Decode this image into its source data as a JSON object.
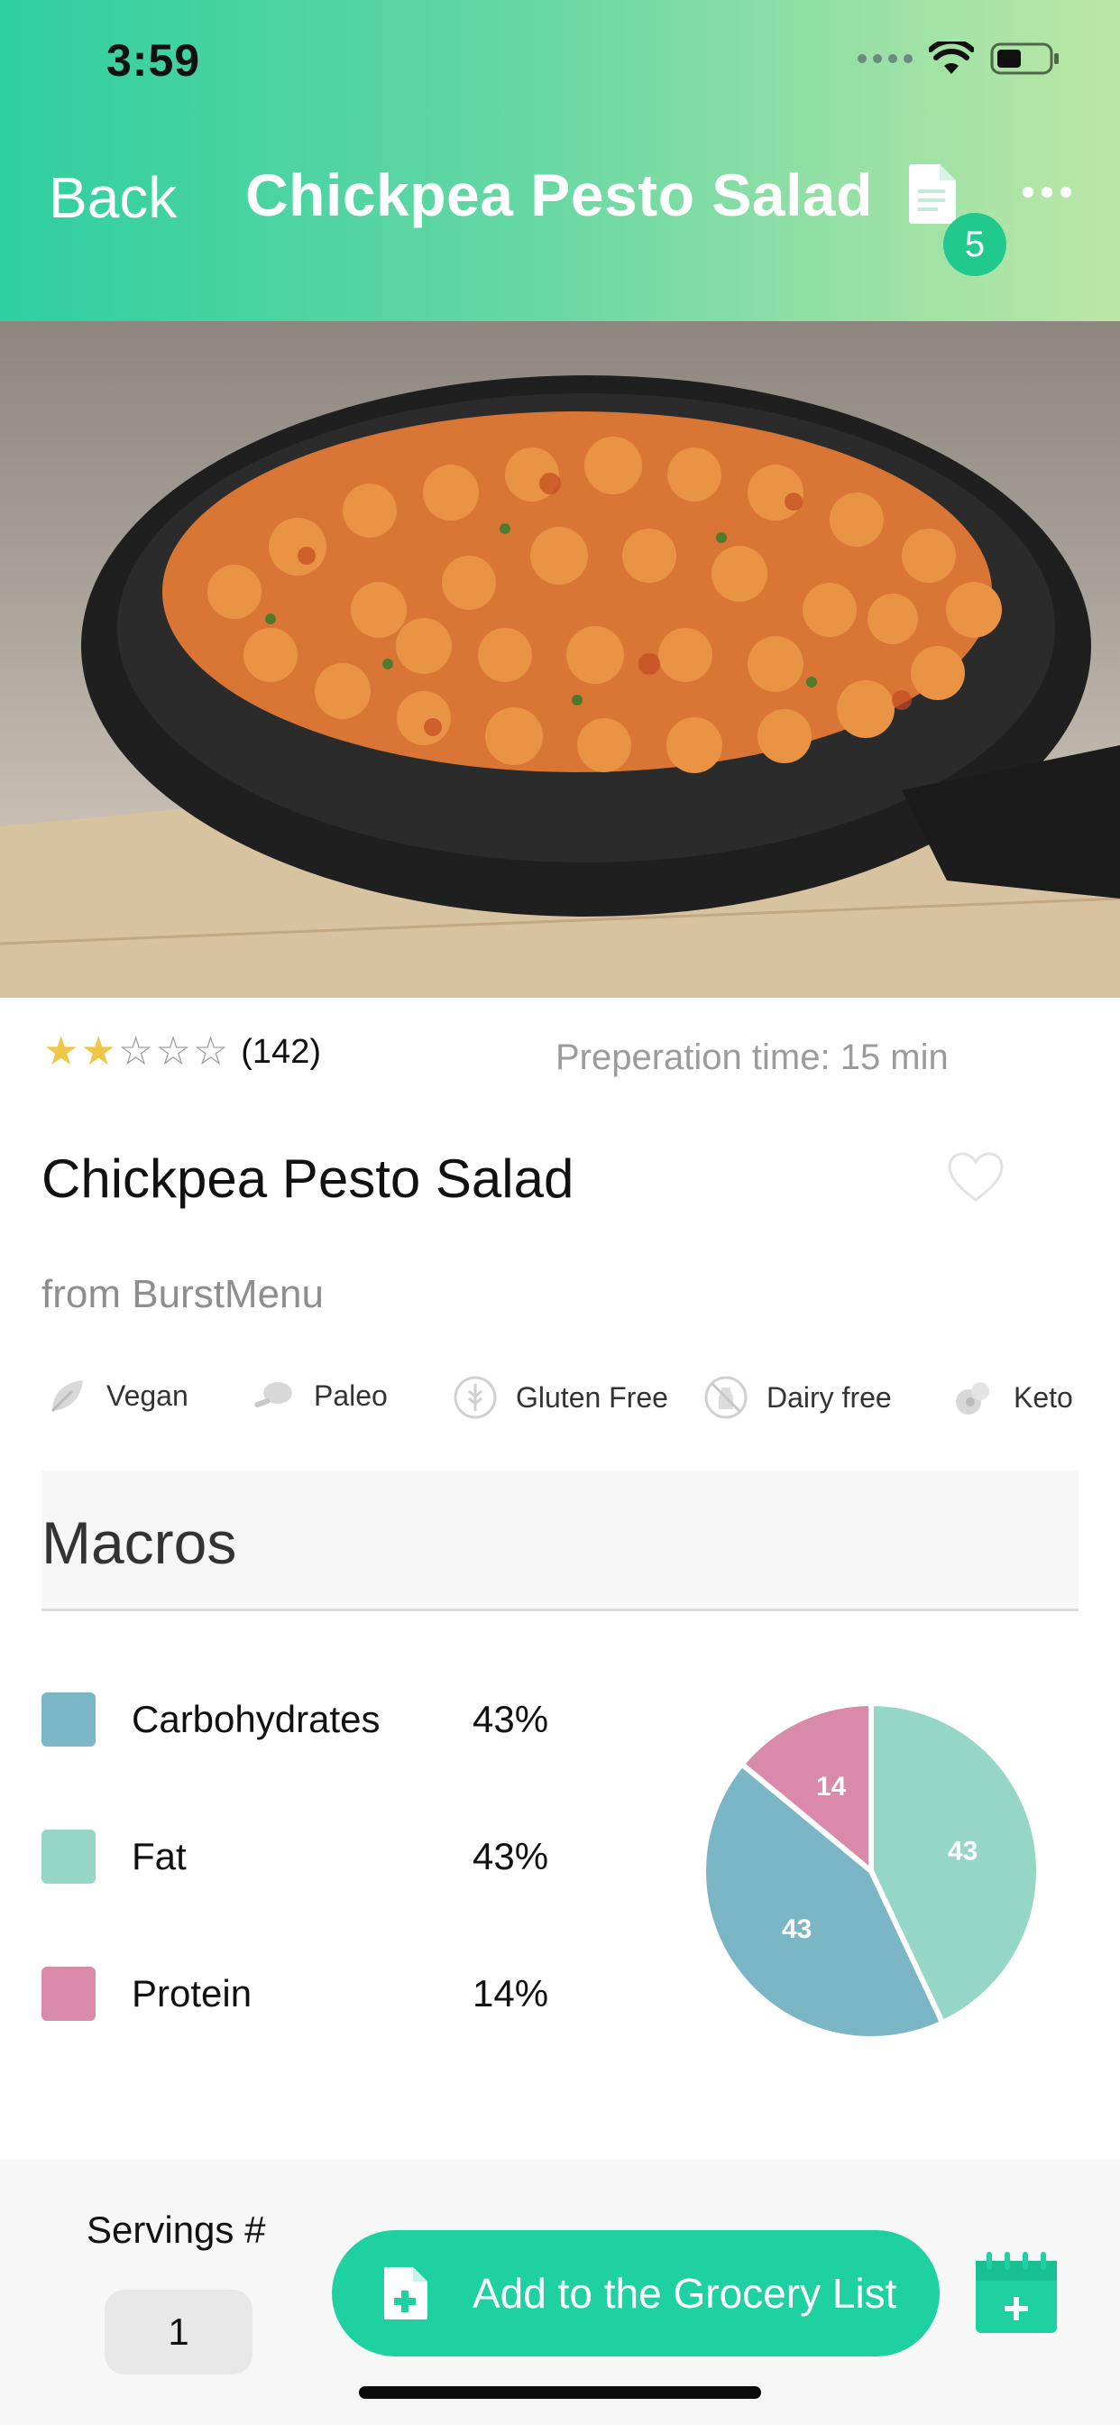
{
  "status_bar": {
    "time": "3:59"
  },
  "nav": {
    "back_label": "Back",
    "title": "Chickpea Pesto Salad",
    "badge_count": "5"
  },
  "recipe": {
    "rating": {
      "stars": 2,
      "max_stars": 5,
      "count_label": "(142)"
    },
    "prep_time_label": "Preperation time: 15 min",
    "title": "Chickpea Pesto Salad",
    "source_label": "from BurstMenu",
    "diets": [
      {
        "label": "Vegan",
        "icon": "leaf-icon"
      },
      {
        "label": "Paleo",
        "icon": "chicken-leg-icon"
      },
      {
        "label": "Gluten Free",
        "icon": "gluten-free-icon"
      },
      {
        "label": "Dairy free",
        "icon": "dairy-free-icon"
      },
      {
        "label": "Keto",
        "icon": "keto-icon"
      }
    ]
  },
  "macros": {
    "title": "Macros",
    "items": [
      {
        "name": "Carbohydrates",
        "percent_label": "43%",
        "color": "#7bb6c6"
      },
      {
        "name": "Fat",
        "percent_label": "43%",
        "color": "#95d6c6"
      },
      {
        "name": "Protein",
        "percent_label": "14%",
        "color": "#d98aa8"
      }
    ]
  },
  "chart_data": {
    "type": "pie",
    "categories": [
      "Fat",
      "Carbohydrates",
      "Protein"
    ],
    "values": [
      43,
      43,
      14
    ],
    "data_labels": [
      "43",
      "43",
      "14"
    ],
    "colors": [
      "#95d6c6",
      "#7bb6c6",
      "#d98aa8"
    ],
    "title": "",
    "legend": "left"
  },
  "bottom_bar": {
    "servings_label": "Servings #",
    "servings_value": "1",
    "grocery_button_label": "Add to the Grocery List"
  },
  "colors": {
    "accent": "#1fd1a1",
    "header_start": "#2fcf9f",
    "header_end": "#bde7a6"
  }
}
